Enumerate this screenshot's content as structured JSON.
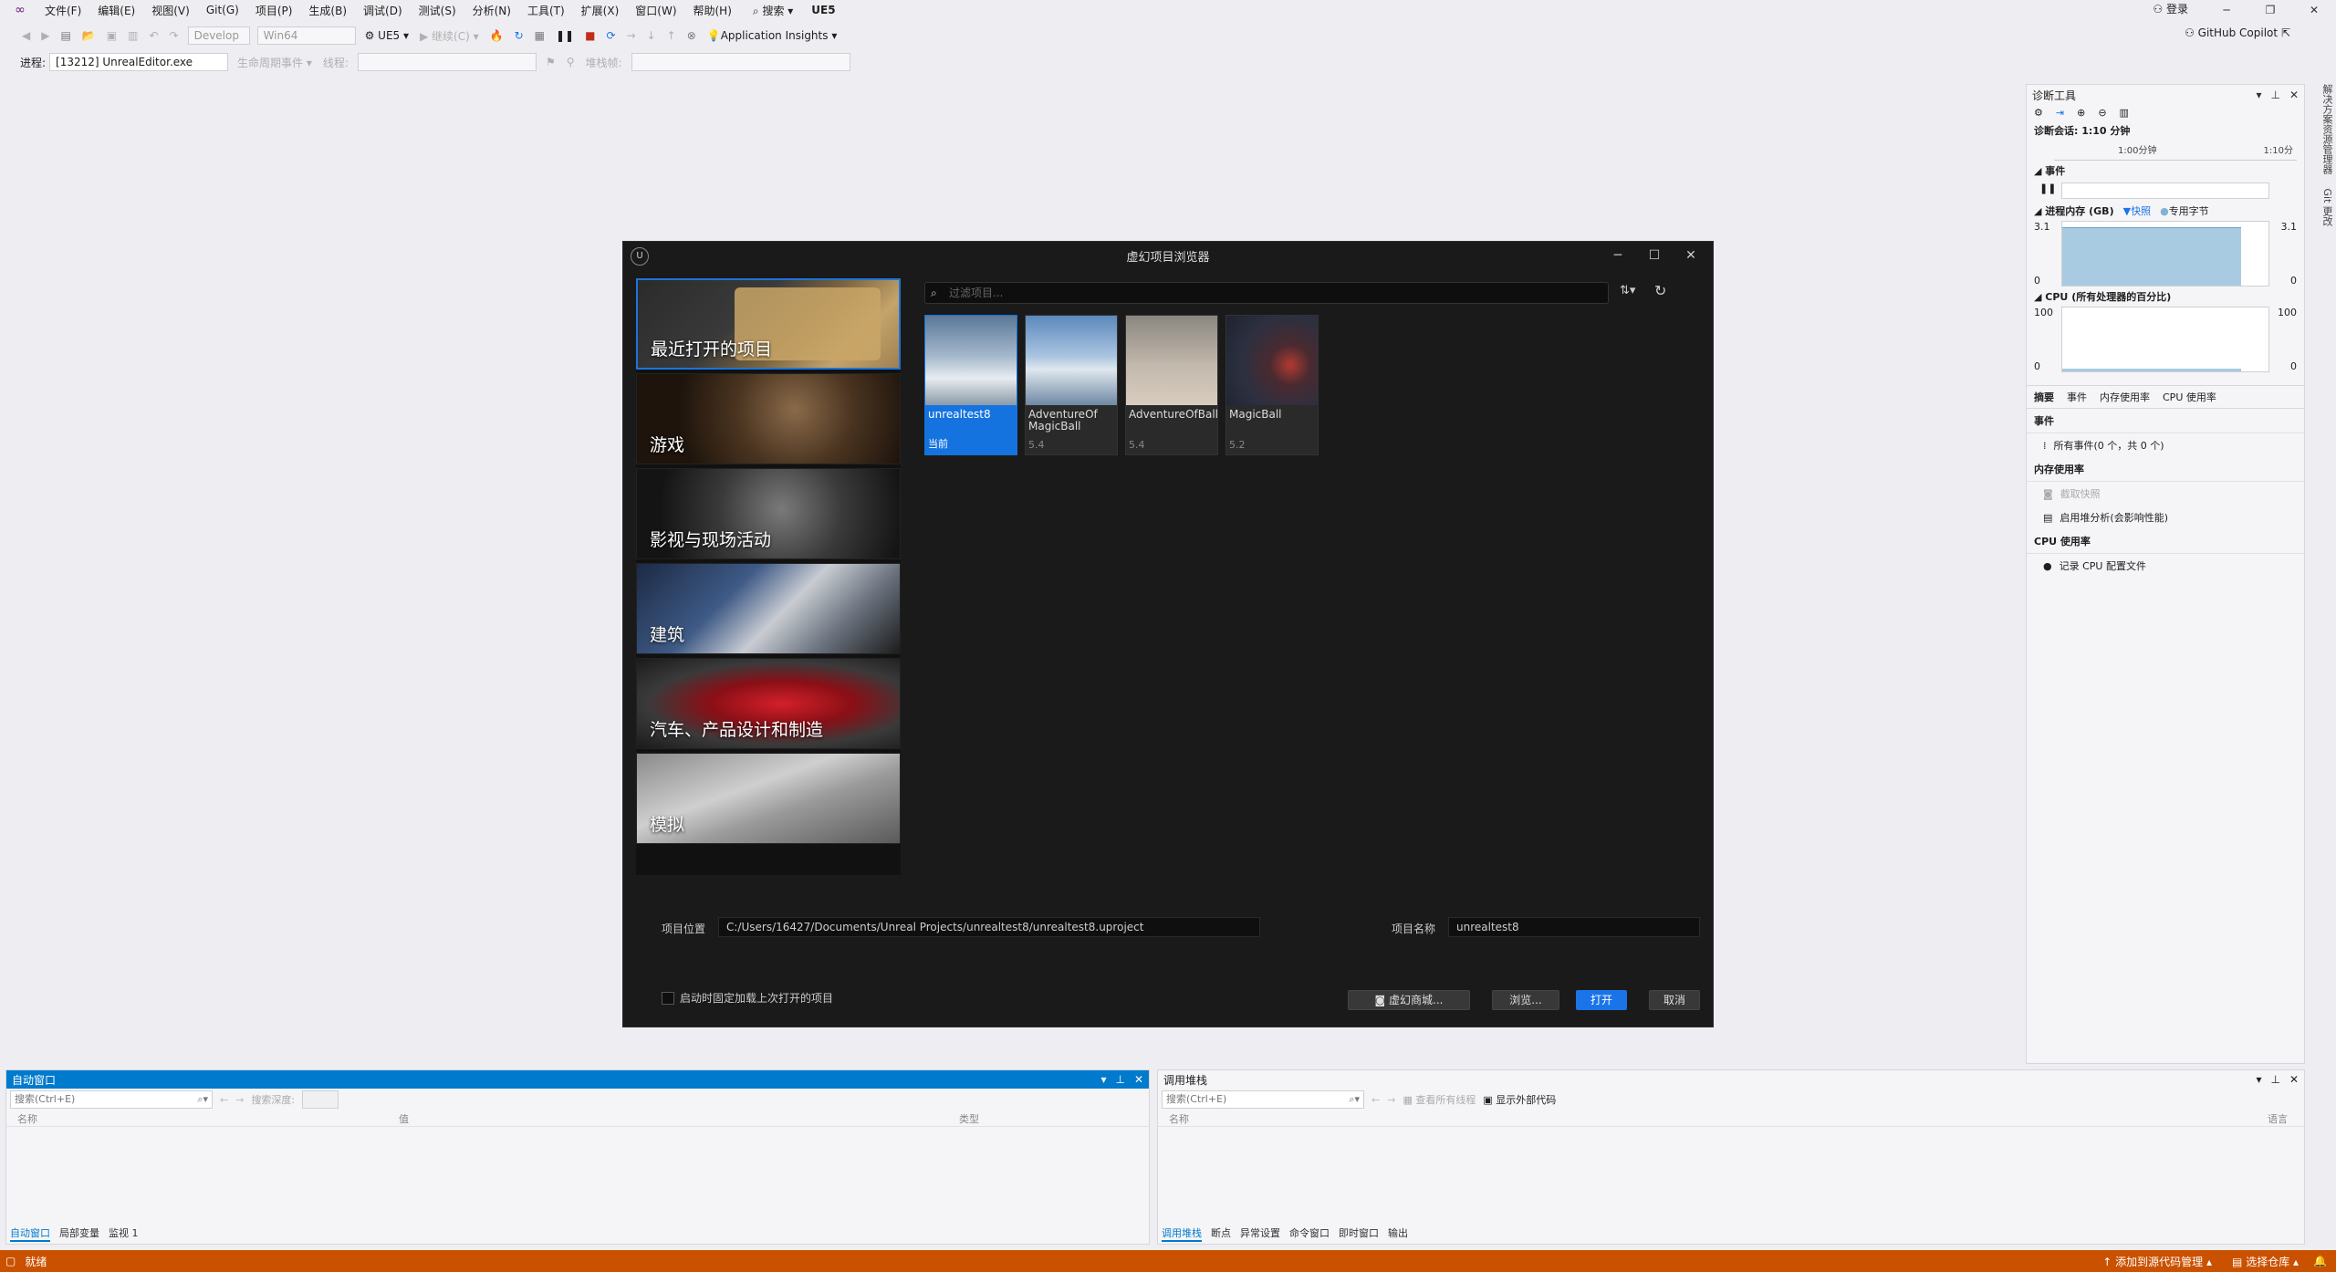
{
  "menu": {
    "items": [
      "文件(F)",
      "编辑(E)",
      "视图(V)",
      "Git(G)",
      "项目(P)",
      "生成(B)",
      "调试(D)",
      "测试(S)",
      "分析(N)",
      "工具(T)",
      "扩展(X)",
      "窗口(W)",
      "帮助(H)"
    ],
    "search_label": "搜索",
    "solution": "UE5",
    "login": "登录",
    "copilot": "GitHub Copilot"
  },
  "toolbar1": {
    "config": "Develop",
    "platform": "Win64",
    "target": "UE5",
    "continue": "继续(C)",
    "app_insights": "Application Insights"
  },
  "toolbar2": {
    "process_label": "进程:",
    "process_value": "[13212] UnrealEditor.exe",
    "lifecycle": "生命周期事件",
    "thread_label": "线程:",
    "stackframe_label": "堆栈帧:"
  },
  "diag": {
    "title": "诊断工具",
    "session": "诊断会话: 1:10 分钟",
    "tick1": "1:00分钟",
    "tick2": "1:10分",
    "events_h": "事件",
    "mem_h": "进程内存 (GB)",
    "legend_snapshot": "快照",
    "legend_private": "专用字节",
    "mem_max": "3.1",
    "mem_min": "0",
    "cpu_h": "CPU (所有处理器的百分比)",
    "cpu_max": "100",
    "cpu_min": "0",
    "tabs": [
      "摘要",
      "事件",
      "内存使用率",
      "CPU 使用率"
    ],
    "sec_events": "事件",
    "all_events": "所有事件(0 个，共 0 个)",
    "sec_mem": "内存使用率",
    "take_snapshot": "截取快照",
    "heap_analysis": "启用堆分析(会影响性能)",
    "sec_cpu": "CPU 使用率",
    "record_cpu": "记录 CPU 配置文件",
    "side_tabs": [
      "解决方案资源管理器",
      "Git 更改"
    ]
  },
  "autos": {
    "title": "自动窗口",
    "search_placeholder": "搜索(Ctrl+E)",
    "search_depth": "搜索深度:",
    "col_name": "名称",
    "col_value": "值",
    "col_type": "类型",
    "tabs": [
      "自动窗口",
      "局部变量",
      "监视 1"
    ]
  },
  "callstack": {
    "title": "调用堆栈",
    "search_placeholder": "搜索(Ctrl+E)",
    "view_threads": "查看所有线程",
    "show_external": "显示外部代码",
    "col_name": "名称",
    "col_lang": "语言",
    "tabs": [
      "调用堆栈",
      "断点",
      "异常设置",
      "命令窗口",
      "即时窗口",
      "输出"
    ]
  },
  "status": {
    "ready": "就绪",
    "add_source": "添加到源代码管理",
    "select_repo": "选择仓库"
  },
  "dialog": {
    "title": "虚幻项目浏览器",
    "filter_placeholder": "过滤项目...",
    "categories": [
      {
        "label": "最近打开的项目",
        "selected": true
      },
      {
        "label": "游戏"
      },
      {
        "label": "影视与现场活动"
      },
      {
        "label": "建筑"
      },
      {
        "label": "汽车、产品设计和制造"
      },
      {
        "label": "模拟"
      }
    ],
    "projects": [
      {
        "name": "unrealtest8",
        "version": "当前",
        "selected": true
      },
      {
        "name": "AdventureOf MagicBall",
        "version": "5.4"
      },
      {
        "name": "AdventureOfBall",
        "version": "5.4"
      },
      {
        "name": "MagicBall",
        "version": "5.2"
      }
    ],
    "location_label": "项目位置",
    "location_value": "C:/Users/16427/Documents/Unreal Projects/unrealtest8/unrealtest8.uproject",
    "name_label": "项目名称",
    "name_value": "unrealtest8",
    "checkbox_label": "启动时固定加载上次打开的项目",
    "btn_market": "虚幻商城...",
    "btn_browse": "浏览...",
    "btn_open": "打开",
    "btn_cancel": "取消"
  }
}
